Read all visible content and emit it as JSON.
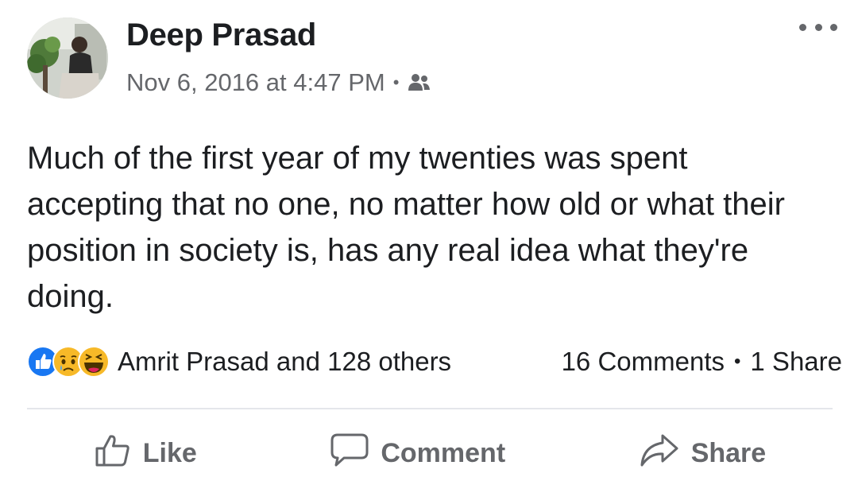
{
  "post": {
    "author": "Deep Prasad",
    "timestamp": "Nov 6, 2016 at 4:47 PM",
    "separator": "•",
    "audience_icon": "friends-icon",
    "more_icon": "more-options-icon",
    "text": "Much of the first year of my twenties was spent accepting that no one, no matter how old or what their position in society is, has any real idea what they're doing."
  },
  "reactions": {
    "icons": [
      "like-reaction-icon",
      "sad-reaction-icon",
      "haha-reaction-icon"
    ],
    "summary": "Amrit Prasad and 128 others",
    "comments": "16 Comments",
    "separator": "•",
    "shares": "1 Share"
  },
  "actions": {
    "like": "Like",
    "comment": "Comment",
    "share": "Share"
  },
  "colors": {
    "text": "#1c1e21",
    "secondary": "#65676b",
    "like_blue": "#1877f2",
    "reaction_yellow": "#f7b928",
    "divider": "#e4e6eb"
  }
}
